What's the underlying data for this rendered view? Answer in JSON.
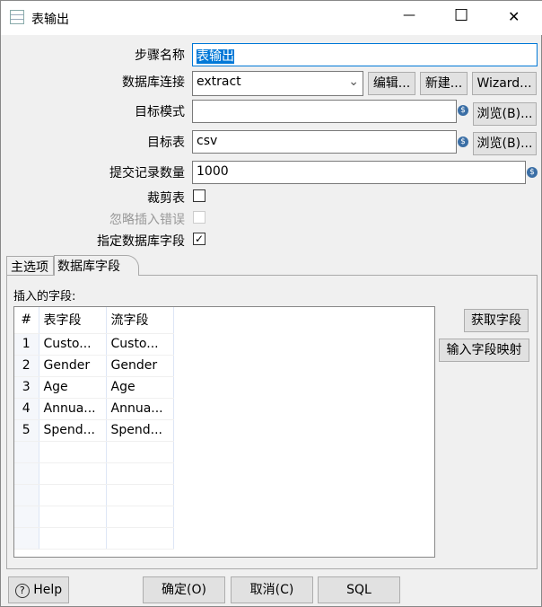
{
  "window": {
    "title": "表输出",
    "minimize": "—",
    "maximize": "☐",
    "close": "✕"
  },
  "form": {
    "step_name_label": "步骤名称",
    "step_name": "表输出",
    "connection_label": "数据库连接",
    "connection": "extract",
    "edit": "编辑...",
    "new": "新建...",
    "wizard": "Wizard...",
    "schema_label": "目标模式",
    "schema": "",
    "browse": "浏览(B)...",
    "table_label": "目标表",
    "table": "csv",
    "commit_label": "提交记录数量",
    "commit": "1000",
    "truncate_label": "裁剪表",
    "ignore_label": "忽略插入错误",
    "specify_label": "指定数据库字段",
    "check": "✓",
    "var": "$"
  },
  "tabs": [
    "主选项",
    "数据库字段"
  ],
  "fields": {
    "label": "插入的字段:",
    "headers": [
      "#",
      "表字段",
      "流字段"
    ],
    "rows": [
      [
        "1",
        "Custo...",
        "Custo..."
      ],
      [
        "2",
        "Gender",
        "Gender"
      ],
      [
        "3",
        "Age",
        "Age"
      ],
      [
        "4",
        "Annua...",
        "Annua..."
      ],
      [
        "5",
        "Spend...",
        "Spend..."
      ]
    ],
    "get_fields": "获取字段",
    "map": "输入字段映射"
  },
  "footer": {
    "help": "Help",
    "ok": "确定(O)",
    "cancel": "取消(C)",
    "sql": "SQL"
  }
}
